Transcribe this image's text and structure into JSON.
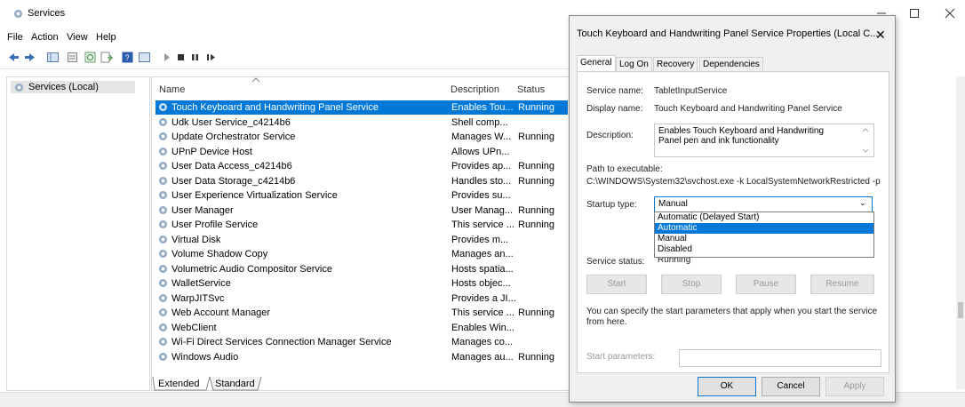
{
  "window": {
    "title": "Services",
    "menu": [
      "File",
      "Action",
      "View",
      "Help"
    ]
  },
  "tree": {
    "root_label": "Services (Local)"
  },
  "list": {
    "columns": {
      "name": "Name",
      "description": "Description",
      "status": "Status"
    },
    "rows": [
      {
        "name": "Touch Keyboard and Handwriting Panel Service",
        "description": "Enables Tou...",
        "status": "Running",
        "selected": true
      },
      {
        "name": "Udk User Service_c4214b6",
        "description": "Shell comp...",
        "status": ""
      },
      {
        "name": "Update Orchestrator Service",
        "description": "Manages W...",
        "status": "Running"
      },
      {
        "name": "UPnP Device Host",
        "description": "Allows UPn...",
        "status": ""
      },
      {
        "name": "User Data Access_c4214b6",
        "description": "Provides ap...",
        "status": "Running"
      },
      {
        "name": "User Data Storage_c4214b6",
        "description": "Handles sto...",
        "status": "Running"
      },
      {
        "name": "User Experience Virtualization Service",
        "description": "Provides su...",
        "status": ""
      },
      {
        "name": "User Manager",
        "description": "User Manag...",
        "status": "Running"
      },
      {
        "name": "User Profile Service",
        "description": "This service ...",
        "status": "Running"
      },
      {
        "name": "Virtual Disk",
        "description": "Provides m...",
        "status": ""
      },
      {
        "name": "Volume Shadow Copy",
        "description": "Manages an...",
        "status": ""
      },
      {
        "name": "Volumetric Audio Compositor Service",
        "description": "Hosts spatia...",
        "status": ""
      },
      {
        "name": "WalletService",
        "description": "Hosts objec...",
        "status": ""
      },
      {
        "name": "WarpJITSvc",
        "description": "Provides a JI...",
        "status": ""
      },
      {
        "name": "Web Account Manager",
        "description": "This service ...",
        "status": "Running"
      },
      {
        "name": "WebClient",
        "description": "Enables Win...",
        "status": ""
      },
      {
        "name": "Wi-Fi Direct Services Connection Manager Service",
        "description": "Manages co...",
        "status": ""
      },
      {
        "name": "Windows Audio",
        "description": "Manages au...",
        "status": "Running"
      }
    ],
    "bottom_tabs": [
      "Extended",
      "Standard"
    ]
  },
  "dialog": {
    "title": "Touch Keyboard and Handwriting Panel Service Properties (Local C...",
    "tabs": [
      "General",
      "Log On",
      "Recovery",
      "Dependencies"
    ],
    "service_name_label": "Service name:",
    "service_name": "TabletInputService",
    "display_name_label": "Display name:",
    "display_name": "Touch Keyboard and Handwriting Panel Service",
    "description_label": "Description:",
    "description": "Enables Touch Keyboard and Handwriting Panel pen and ink functionality",
    "path_label": "Path to executable:",
    "path": "C:\\WINDOWS\\System32\\svchost.exe -k LocalSystemNetworkRestricted -p",
    "startup_label": "Startup type:",
    "startup_value": "Manual",
    "startup_options": [
      "Automatic (Delayed Start)",
      "Automatic",
      "Manual",
      "Disabled"
    ],
    "startup_highlighted": "Automatic",
    "status_label": "Service status:",
    "status_value": "Running",
    "buttons": {
      "start": "Start",
      "stop": "Stop",
      "pause": "Pause",
      "resume": "Resume"
    },
    "hint": "You can specify the start parameters that apply when you start the service from here.",
    "params_label": "Start parameters:",
    "ok": "OK",
    "cancel": "Cancel",
    "apply": "Apply"
  },
  "colors": {
    "selection": "#0078d7",
    "dialog_bg": "#f0f0f0"
  }
}
